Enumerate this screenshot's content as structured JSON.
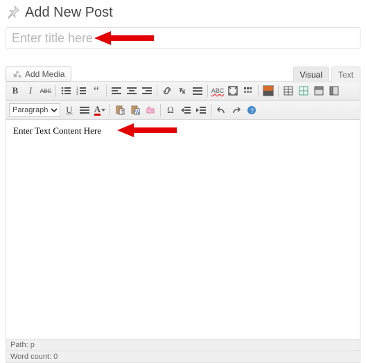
{
  "header": {
    "title": "Add New Post"
  },
  "title_field": {
    "placeholder": "Enter title here",
    "value": ""
  },
  "media_button": {
    "label": "Add Media"
  },
  "tabs": {
    "visual": "Visual",
    "text": "Text",
    "active": "visual"
  },
  "format_select": {
    "value": "Paragraph"
  },
  "toolbar_row1": {
    "bold": "B",
    "italic": "I",
    "strike": "ABC",
    "ul": "bulleted-list",
    "ol": "numbered-list",
    "quote": "blockquote",
    "alignleft": "align-left",
    "aligncenter": "align-center",
    "alignright": "align-right",
    "link": "link",
    "unlink": "unlink",
    "more": "more-tag",
    "spell": "spellcheck",
    "fullscreen": "fullscreen",
    "kitchensink": "toggle-toolbar",
    "forms": "forms-button",
    "forms_color": "#d66b2a",
    "tbl1": "table-1",
    "tbl2": "table-2",
    "tbl3": "table-3",
    "tbl4": "table-4"
  },
  "toolbar_row2": {
    "underline": "U",
    "alignjustify": "align-justify",
    "textcolor": "A",
    "paste": "paste-text",
    "pasteword": "paste-word",
    "clear": "clear-formatting",
    "char": "Ω",
    "outdent": "outdent",
    "indent": "indent",
    "undo": "undo",
    "redo": "redo",
    "help": "?"
  },
  "content": {
    "placeholder_text": "Enter Text Content Here"
  },
  "status": {
    "path_label": "Path:",
    "path_value": "p",
    "wordcount_label": "Word count:",
    "wordcount_value": 0
  }
}
